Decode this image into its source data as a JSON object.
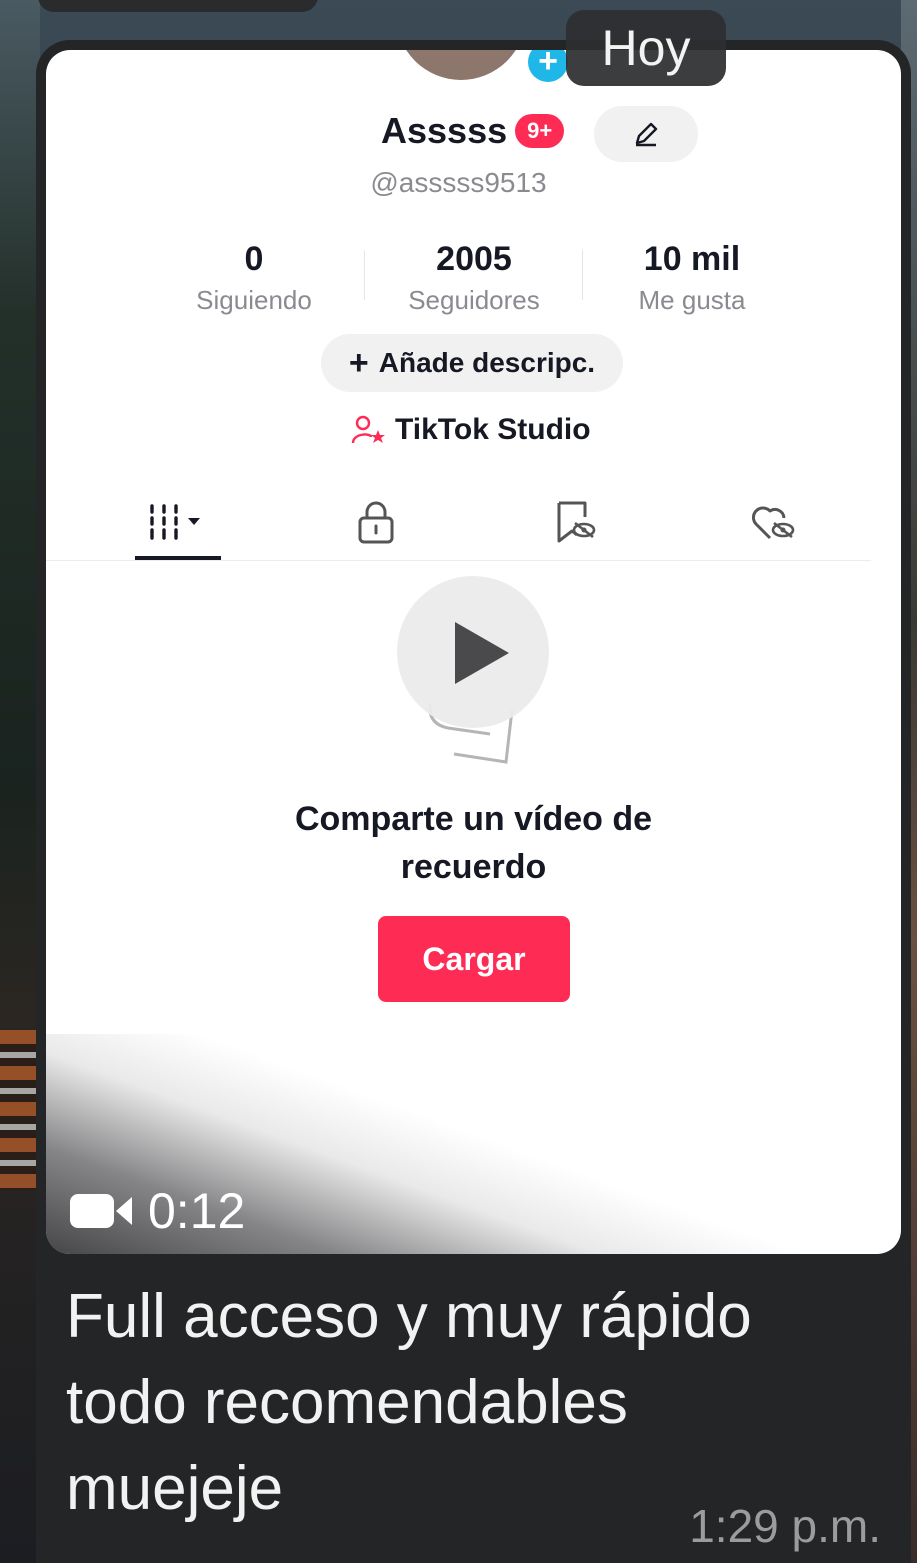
{
  "chat": {
    "date_chip": "Hoy",
    "message_caption": "Full acceso y muy rápido\ntodo recomendables\nmuejeje",
    "message_time": "1:29 p.m.",
    "video_duration": "0:12"
  },
  "profile": {
    "display_name": "Asssss",
    "notification_badge": "9+",
    "username": "@asssss9513",
    "stats": [
      {
        "value": "0",
        "label": "Siguiendo"
      },
      {
        "value": "2005",
        "label": "Seguidores"
      },
      {
        "value": "10 mil",
        "label": "Me gusta"
      }
    ],
    "add_description_label": "Añade descripc.",
    "studio_label": "TikTok Studio"
  },
  "tabs": [
    {
      "icon": "videos-grid-icon",
      "active": true
    },
    {
      "icon": "lock-icon",
      "active": false
    },
    {
      "icon": "hidden-saved-icon",
      "active": false
    },
    {
      "icon": "hidden-likes-icon",
      "active": false
    }
  ],
  "empty_state": {
    "text": "Comparte un vídeo de recuerdo",
    "upload_label": "Cargar"
  },
  "colors": {
    "accent": "#fe2c55",
    "bubble": "#232526",
    "avatar_plus": "#1fb7e8"
  }
}
